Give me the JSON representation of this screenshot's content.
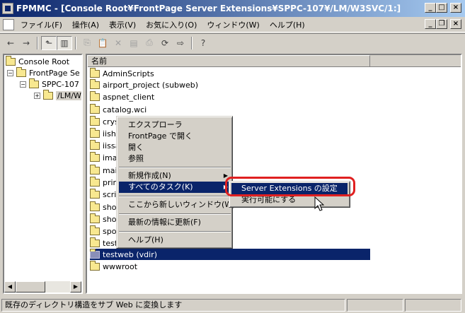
{
  "window": {
    "title": "FPMMC - [Console Root¥FrontPage Server Extensions¥SPPC-107¥/LM/W3SVC/1:]",
    "minimize": "_",
    "maximize": "□",
    "close": "×"
  },
  "menubar": {
    "items": [
      "ファイル(F)",
      "操作(A)",
      "表示(V)",
      "お気に入り(O)",
      "ウィンドウ(W)",
      "ヘルプ(H)"
    ]
  },
  "toolbar": {
    "buttons": [
      "back-icon",
      "forward-icon",
      "up-folder-icon",
      "show-hide-tree-icon",
      "copy-icon",
      "paste-icon",
      "delete-icon",
      "properties-icon",
      "print-icon",
      "refresh-icon",
      "export-list-icon",
      "help-icon"
    ]
  },
  "tree": {
    "items": [
      {
        "label": "Console Root",
        "expander": ""
      },
      {
        "label": "FrontPage Se",
        "expander": "−"
      },
      {
        "label": "SPPC-107",
        "expander": "−"
      },
      {
        "label": "/LM/W",
        "expander": "+"
      }
    ]
  },
  "list": {
    "column_header": "名前",
    "items": [
      "AdminScripts",
      "airport_project (subweb)",
      "aspnet_client",
      "catalog.wci",
      "crys",
      "iishe",
      "iissa",
      "imag",
      "mail",
      "print",
      "scrip",
      "shoo",
      "shoo",
      "spot",
      "testi",
      "testweb (vdir)",
      "wwwroot"
    ],
    "selected": "testweb (vdir)"
  },
  "context_menu": {
    "items": [
      "エクスプローラ",
      "FrontPage で開く",
      "開く",
      "参照",
      "新規作成(N)",
      "すべてのタスク(K)",
      "ここから新しいウィンドウ(W)",
      "最新の情報に更新(F)",
      "ヘルプ(H)"
    ],
    "highlighted": "すべてのタスク(K)"
  },
  "submenu": {
    "items": [
      "Server Extensions の設定",
      "実行可能にする"
    ],
    "highlighted": "Server Extensions の設定"
  },
  "status": {
    "text": "既存のディレクトリ構造をサブ Web に変換します"
  },
  "colors": {
    "titlebar_start": "#0a246a",
    "titlebar_end": "#a6caf0",
    "selection": "#0a246a",
    "annotation_ring": "#e02020"
  }
}
